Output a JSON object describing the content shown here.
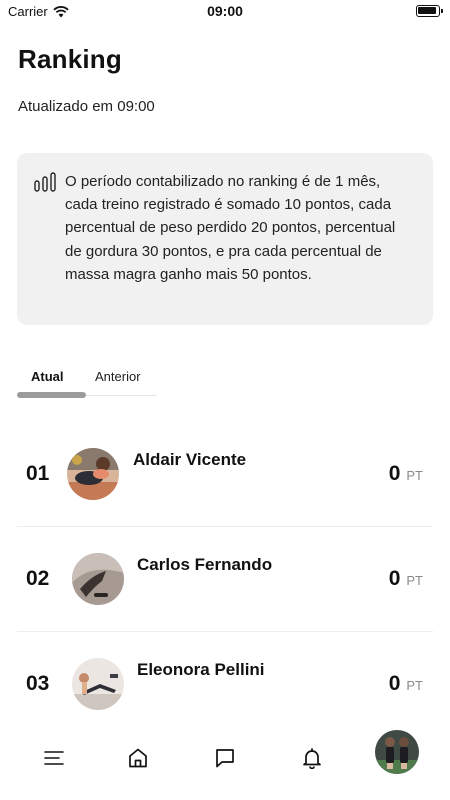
{
  "status_bar": {
    "carrier": "Carrier",
    "time": "09:00"
  },
  "header": {
    "title": "Ranking",
    "updated": "Atualizado em 09:00"
  },
  "info": {
    "icon": "bar-chart-icon",
    "text": "O período contabilizado no ranking é de 1 mês, cada treino registrado é somado 10 pontos, cada percentual de peso perdido 20 pontos, percentual de gordura 30 pontos, e pra cada percentual de massa magra ganho mais 50 pontos."
  },
  "tabs": [
    {
      "label": "Atual",
      "active": true
    },
    {
      "label": "Anterior",
      "active": false
    }
  ],
  "ranking": [
    {
      "position": "01",
      "name": "Aldair Vicente",
      "points": "0",
      "unit": "PT"
    },
    {
      "position": "02",
      "name": "Carlos Fernando",
      "points": "0",
      "unit": "PT"
    },
    {
      "position": "03",
      "name": "Eleonora Pellini",
      "points": "0",
      "unit": "PT"
    }
  ],
  "bottom_nav": {
    "items": [
      "menu-icon",
      "home-icon",
      "chat-icon",
      "bell-icon",
      "profile-avatar"
    ]
  },
  "colors": {
    "accent": "#9b9b9b",
    "card_bg": "#f1f1f1",
    "text": "#111111",
    "muted": "#8a8a8a"
  }
}
